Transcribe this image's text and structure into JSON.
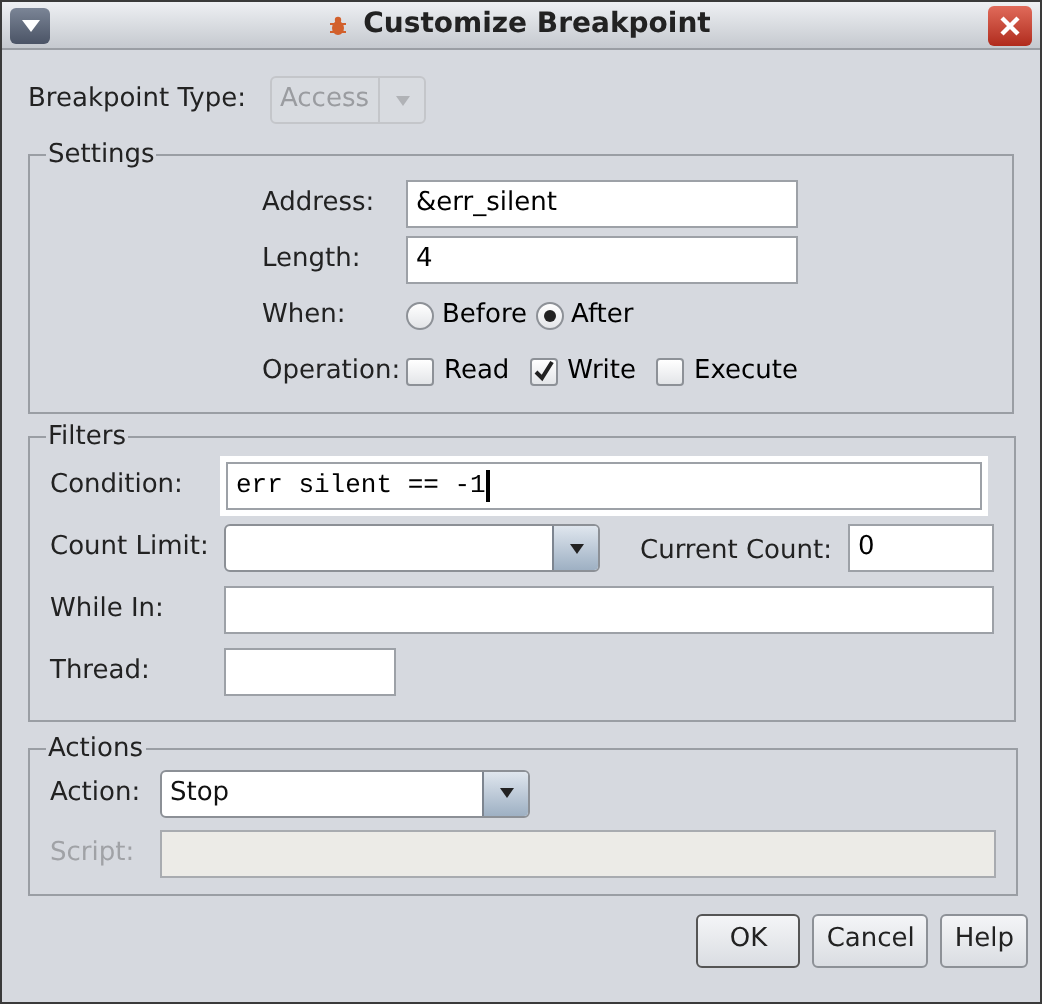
{
  "window": {
    "title": "Customize Breakpoint"
  },
  "breakpoint_type": {
    "label": "Breakpoint Type:",
    "value": "Access",
    "disabled": true
  },
  "settings": {
    "title": "Settings",
    "address": {
      "label": "Address:",
      "value": "&err_silent"
    },
    "length": {
      "label": "Length:",
      "value": "4"
    },
    "when": {
      "label": "When:",
      "options": [
        {
          "label": "Before",
          "selected": false
        },
        {
          "label": "After",
          "selected": true
        }
      ]
    },
    "operation": {
      "label": "Operation:",
      "options": [
        {
          "label": "Read",
          "checked": false
        },
        {
          "label": "Write",
          "checked": true
        },
        {
          "label": "Execute",
          "checked": false
        }
      ]
    }
  },
  "filters": {
    "title": "Filters",
    "condition": {
      "label": "Condition:",
      "value": "err silent == -1",
      "focused": true
    },
    "count_limit": {
      "label": "Count Limit:"
    },
    "current_count": {
      "label": "Current Count:",
      "value": "0"
    },
    "while_in": {
      "label": "While In:"
    },
    "thread": {
      "label": "Thread:"
    }
  },
  "actions": {
    "title": "Actions",
    "action": {
      "label": "Action:",
      "value": "Stop"
    },
    "script": {
      "label": "Script:",
      "disabled": true
    }
  },
  "buttons": [
    {
      "label": "OK",
      "default": true
    },
    {
      "label": "Cancel",
      "default": false
    },
    {
      "label": "Help",
      "default": false
    }
  ]
}
